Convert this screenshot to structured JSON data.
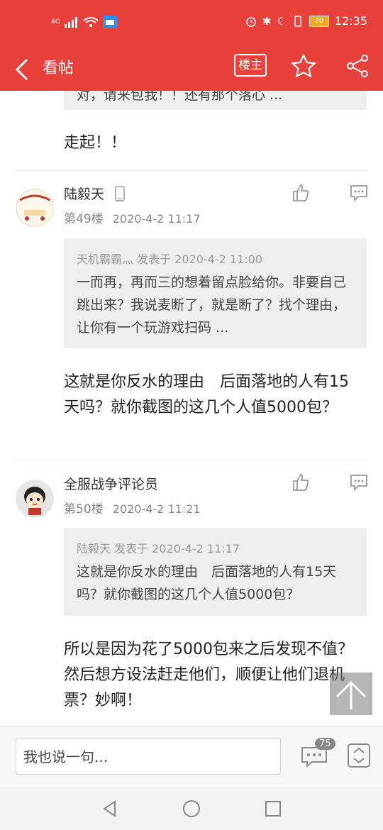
{
  "status_bar": {
    "network": "4G",
    "battery": "20",
    "time": "12:35"
  },
  "app_bar": {
    "title": "看帖",
    "op_label": "楼主"
  },
  "top_partial": {
    "quote_text": "对，请来包我！！还有那个落心 ...",
    "body": "走起！！"
  },
  "posts": [
    {
      "username": "陆毅天",
      "floor": "第49楼",
      "time": "2020-4-2 11:17",
      "quote_head": "天机霸霸灬 发表于 2020-4-2 11:00",
      "quote_text": "一而再，再而三的想着留点脸给你。非要自己跳出来？我说麦断了，就是断了？找个理由，让你有一个玩游戏扫码 ...",
      "body": "这就是你反水的理由　后面落地的人有15天吗？就你截图的这几个人值5000包？"
    },
    {
      "username": "全服战争评论员",
      "floor": "第50楼",
      "time": "2020-4-2 11:21",
      "quote_head": "陆毅天 发表于 2020-4-2 11:17",
      "quote_text": "这就是你反水的理由　后面落地的人有15天吗？就你截图的这几个人值5000包？",
      "body": "所以是因为花了5000包来之后发现不值？然后想方设法赶走他们，顺便让他们退机票？妙啊！"
    }
  ],
  "reply": {
    "placeholder": "我也说一句...",
    "comment_count": "75"
  },
  "colors": {
    "brand": "#e8403b",
    "quote_bg": "#eeeeee"
  }
}
